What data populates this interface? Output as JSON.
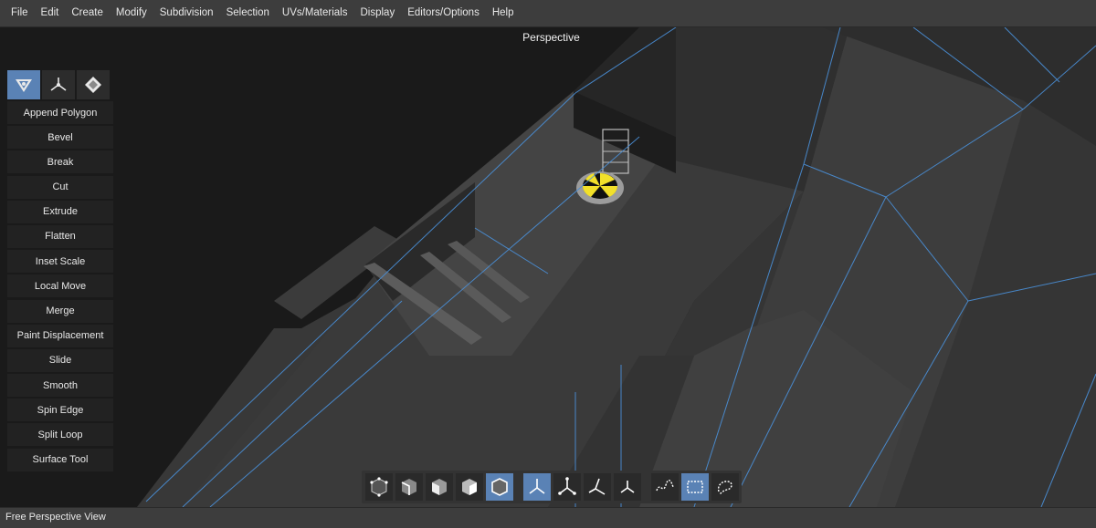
{
  "menu": {
    "items": [
      "File",
      "Edit",
      "Create",
      "Modify",
      "Subdivision",
      "Selection",
      "UVs/Materials",
      "Display",
      "Editors/Options",
      "Help"
    ]
  },
  "viewport": {
    "title": "Perspective"
  },
  "tool_panel": {
    "modes": [
      {
        "name": "mesh-mode-icon",
        "active": true
      },
      {
        "name": "transform-mode-icon",
        "active": false
      },
      {
        "name": "uv-mode-icon",
        "active": false
      }
    ],
    "tools": [
      "Append Polygon",
      "Bevel",
      "Break",
      "Cut",
      "Extrude",
      "Flatten",
      "Inset Scale",
      "Local Move",
      "Merge",
      "Paint Displacement",
      "Slide",
      "Smooth",
      "Spin Edge",
      "Split Loop",
      "Surface Tool"
    ]
  },
  "bottom_toolbar": {
    "groups": [
      [
        "vertex-select-icon",
        "edge-select-icon",
        "face-select-icon",
        "uv-select-icon",
        "object-select-icon"
      ],
      [
        "world-axis-icon",
        "object-axis-icon",
        "local-axis-icon",
        "screen-axis-icon"
      ],
      [
        "lasso-paint-icon",
        "marquee-select-icon",
        "lasso-select-icon"
      ]
    ],
    "active": [
      "object-select-icon",
      "world-axis-icon",
      "marquee-select-icon"
    ]
  },
  "status": {
    "text": "Free Perspective View"
  },
  "colors": {
    "accent": "#5a82b5",
    "edge_highlight": "#4a90d9",
    "marker_yellow": "#f2e02a"
  }
}
